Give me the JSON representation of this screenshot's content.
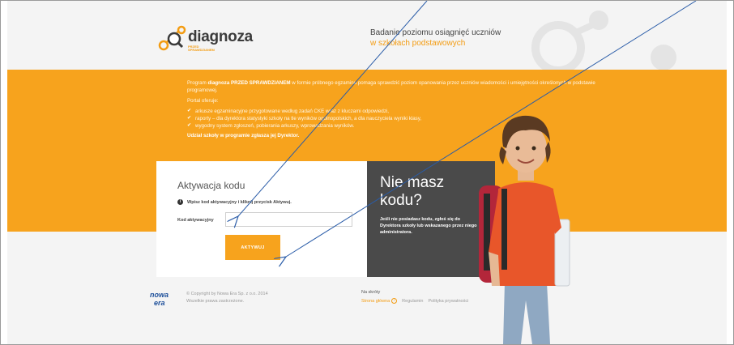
{
  "header": {
    "logo_word": "diagnoza",
    "logo_sub": "PRZED SPRAWDZIANEM",
    "tagline_line1": "Badanie poziomu osiągnięć uczniów",
    "tagline_line2": "w szkołach podstawowych"
  },
  "intro": {
    "p1_prefix": "Program ",
    "p1_bold": "diagnoza PRZED SPRAWDZIANEM",
    "p1_suffix": " w formie próbnego egzaminu pomaga sprawdzić poziom opanowania przez uczniów wiadomości i umiejętności określonych w podstawie programowej.",
    "portal_label": "Portal oferuje:",
    "bullets": [
      "arkusze egzaminacyjne przygotowane według zadań CKE wraz z kluczami odpowiedzi,",
      "raporty – dla dyrektora statystyki szkoły na tle wyników ogólnopolskich, a dla nauczyciela wyniki klasy,",
      "wygodny system zgłoszeń, pobierania arkuszy, wprowadzania wyników."
    ],
    "participation": "Udział szkoły w programie zgłasza jej Dyrektor."
  },
  "activation": {
    "title": "Aktywacja kodu",
    "hint": "Wpisz kod aktywacyjny i kliknij przycisk Aktywuj.",
    "field_label": "Kod aktywacyjny",
    "field_value": "",
    "button_label": "AKTYWUJ"
  },
  "no_code": {
    "title": "Nie masz kodu?",
    "text": "Jeśli nie posiadasz kodu, zgłoś się do Dyrektora szkoły lub wskazanego przez niego administratora."
  },
  "footer": {
    "logo_line1": "nowa",
    "logo_line2": "era",
    "copyright": "© Copyright by Nowa Era Sp. z o.o. 2014",
    "rights": "Wszelkie prawa zastrzeżone.",
    "shortcuts_title": "Na skróty",
    "link_home": "Strona główna",
    "link_rules": "Regulamin",
    "link_privacy": "Polityka prywatności"
  },
  "colors": {
    "accent": "#f7a31d",
    "dark_panel": "#4a4a4a",
    "arrow": "#2a5ca8"
  },
  "icons": [
    "logo-icon",
    "info-icon",
    "check-icon",
    "home-icon",
    "annotation-arrow"
  ]
}
